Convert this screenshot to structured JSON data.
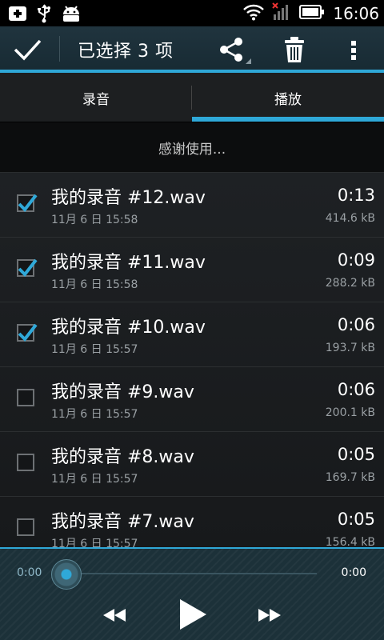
{
  "status_bar": {
    "time": "16:06"
  },
  "action_bar": {
    "title": "已选择 3 项"
  },
  "tabs": [
    {
      "label": "录音",
      "selected": false
    },
    {
      "label": "播放",
      "selected": true
    }
  ],
  "banner": {
    "text": "感谢使用..."
  },
  "recordings": [
    {
      "name": "我的录音 #12.wav",
      "date": "11月 6 日 15:58",
      "duration": "0:13",
      "size": "414.6 kB",
      "checked": true
    },
    {
      "name": "我的录音 #11.wav",
      "date": "11月 6 日 15:58",
      "duration": "0:09",
      "size": "288.2 kB",
      "checked": true
    },
    {
      "name": "我的录音 #10.wav",
      "date": "11月 6 日 15:57",
      "duration": "0:06",
      "size": "193.7 kB",
      "checked": true
    },
    {
      "name": "我的录音 #9.wav",
      "date": "11月 6 日 15:57",
      "duration": "0:06",
      "size": "200.1 kB",
      "checked": false
    },
    {
      "name": "我的录音 #8.wav",
      "date": "11月 6 日 15:57",
      "duration": "0:05",
      "size": "169.7 kB",
      "checked": false
    },
    {
      "name": "我的录音 #7.wav",
      "date": "11月 6 日 15:57",
      "duration": "0:05",
      "size": "156.4 kB",
      "checked": false
    }
  ],
  "player": {
    "current_time": "0:00",
    "total_time": "0:00",
    "progress": 0
  },
  "colors": {
    "accent": "#2fa8d8",
    "action_bar": "#1c2f38",
    "background": "#0b0c0d"
  },
  "icons": {
    "status_left": [
      "usb-debugging-icon",
      "usb-icon",
      "android-icon"
    ],
    "status_right": [
      "wifi-icon",
      "signal-icon",
      "battery-icon"
    ],
    "action_bar": [
      "done-check-icon",
      "share-icon",
      "trash-icon",
      "overflow-menu-icon"
    ],
    "player": [
      "rewind-icon",
      "play-icon",
      "fast-forward-icon"
    ]
  }
}
